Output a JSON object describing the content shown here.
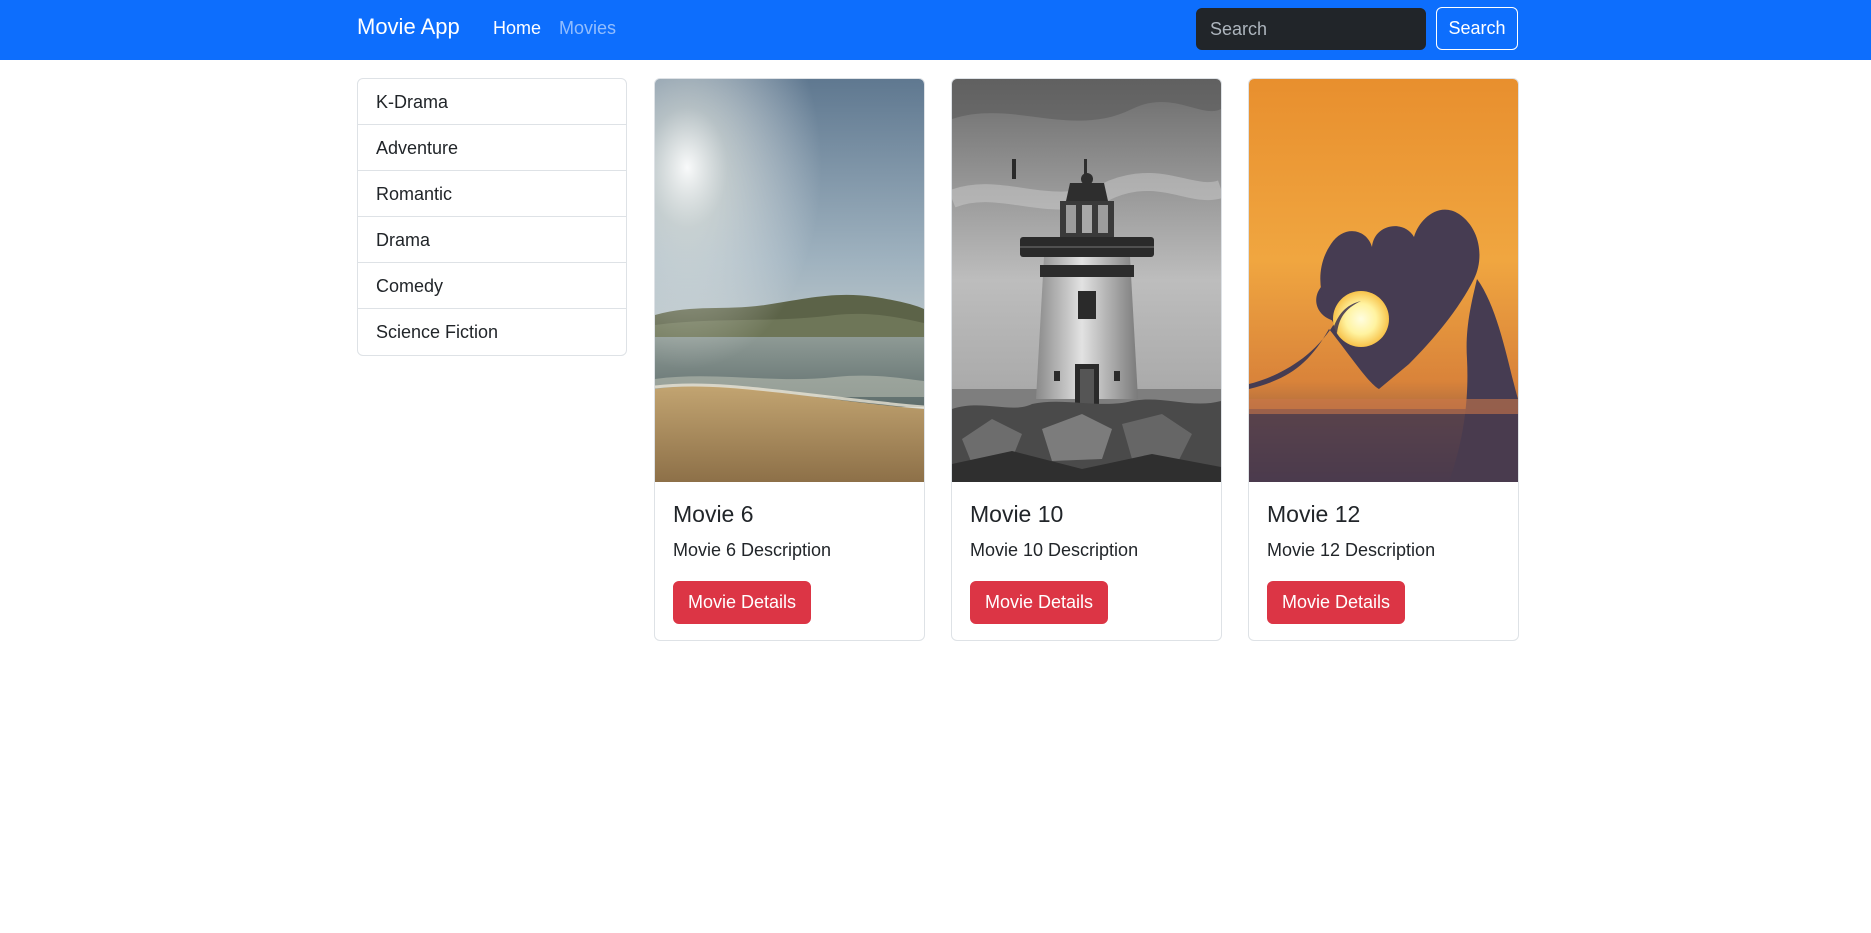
{
  "navbar": {
    "brand": "Movie App",
    "links": [
      {
        "label": "Home",
        "active": true
      },
      {
        "label": "Movies",
        "active": false
      }
    ],
    "search": {
      "placeholder": "Search",
      "value": "",
      "button_label": "Search"
    },
    "colors": {
      "background": "#0d6efd"
    }
  },
  "sidebar": {
    "categories": [
      {
        "label": "K-Drama"
      },
      {
        "label": "Adventure"
      },
      {
        "label": "Romantic"
      },
      {
        "label": "Drama"
      },
      {
        "label": "Comedy"
      },
      {
        "label": "Science Fiction"
      }
    ]
  },
  "movies": [
    {
      "title": "Movie 6",
      "description": "Movie 6 Description",
      "button_label": "Movie Details",
      "image": "beach-photo"
    },
    {
      "title": "Movie 10",
      "description": "Movie 10 Description",
      "button_label": "Movie Details",
      "image": "lighthouse-photo"
    },
    {
      "title": "Movie 12",
      "description": "Movie 12 Description",
      "button_label": "Movie Details",
      "image": "heart-sunset-photo"
    }
  ],
  "colors": {
    "primary": "#0d6efd",
    "danger": "#dc3545",
    "input_dark": "#212529"
  }
}
